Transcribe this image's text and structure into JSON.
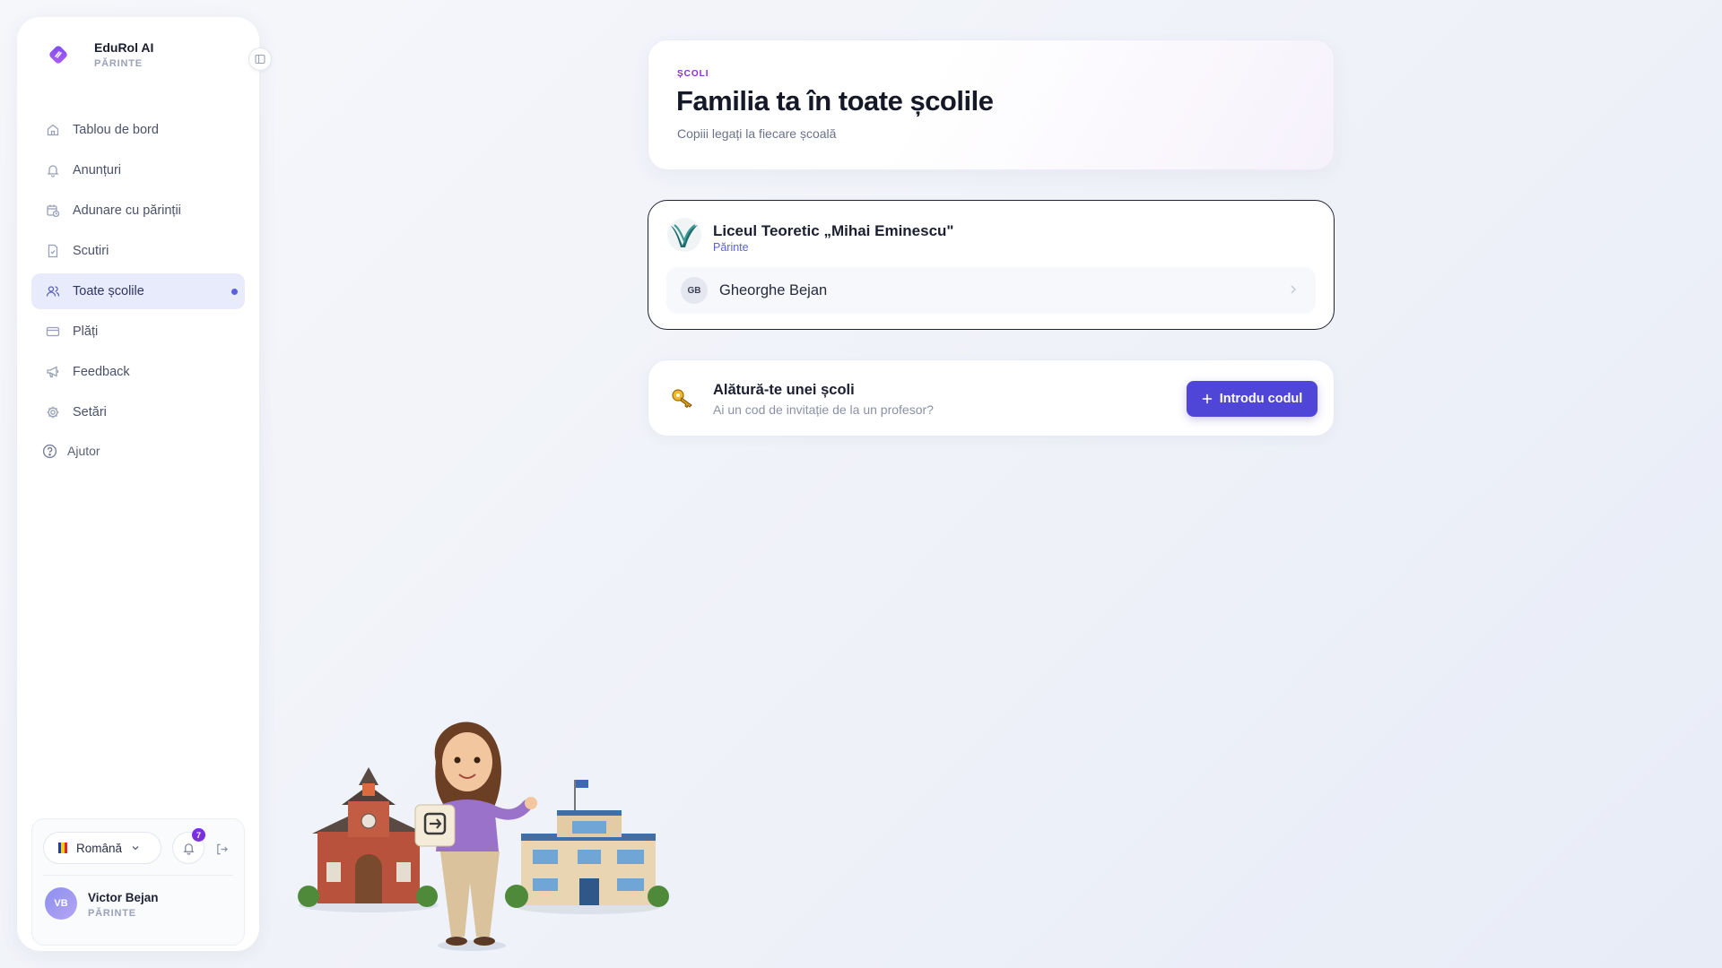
{
  "brand": {
    "name": "EduRol AI",
    "role": "PĂRINTE"
  },
  "sidebar": {
    "items": [
      {
        "label": "Tablou de bord",
        "icon": "home-icon"
      },
      {
        "label": "Anunțuri",
        "icon": "bell-icon"
      },
      {
        "label": "Adunare cu părinții",
        "icon": "calendar-clock-icon"
      },
      {
        "label": "Scutiri",
        "icon": "document-check-icon"
      },
      {
        "label": "Toate școlile",
        "icon": "users-icon",
        "active": true
      },
      {
        "label": "Plăți",
        "icon": "credit-card-icon"
      },
      {
        "label": "Feedback",
        "icon": "megaphone-icon"
      },
      {
        "label": "Setări",
        "icon": "gear-icon"
      }
    ],
    "help": {
      "label": "Ajutor",
      "icon": "help-circle-icon"
    }
  },
  "user_panel": {
    "language": "Română",
    "notifications_count": "7",
    "avatar_initials": "VB",
    "name": "Victor Bejan",
    "role": "PĂRINTE"
  },
  "hero": {
    "eyebrow": "ȘCOLI",
    "title": "Familia ta în toate școlile",
    "subtitle": "Copiii legați la fiecare școală"
  },
  "school": {
    "name": "Liceul Teoretic „Mihai Eminescu\"",
    "role": "Părinte",
    "children": [
      {
        "initials": "GB",
        "name": "Gheorghe Bejan"
      }
    ]
  },
  "join": {
    "title": "Alătură-te unei școli",
    "subtitle": "Ai un cod de invitație de la un profesor?",
    "button_label": "Introdu codul"
  },
  "colors": {
    "accent": "#4f46d8",
    "eyebrow": "#8b2fc9",
    "active_bg": "#e8ebfb",
    "badge": "#7a2fe0"
  }
}
